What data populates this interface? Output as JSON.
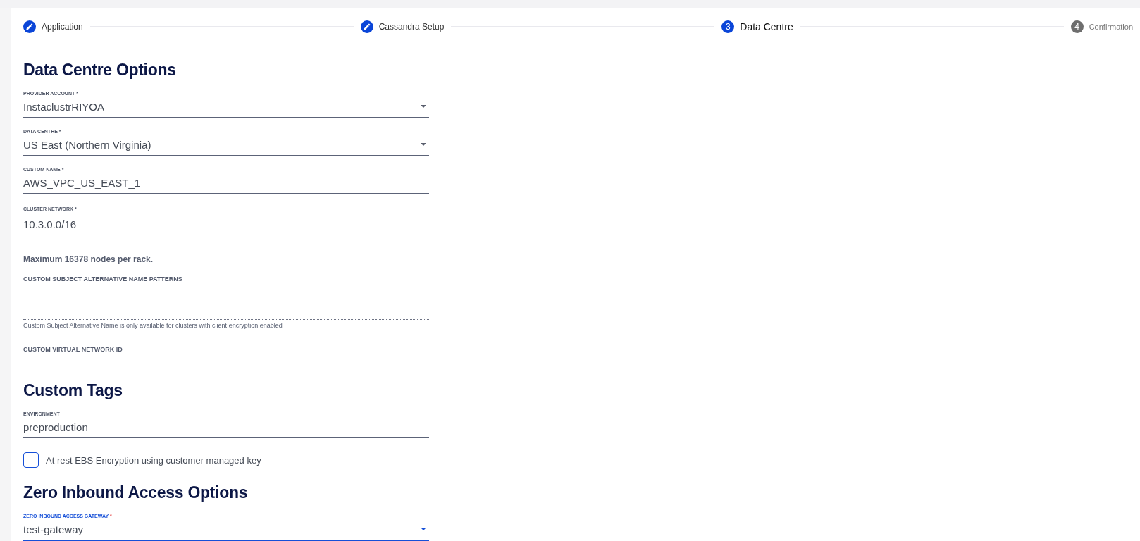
{
  "stepper": [
    {
      "label": "Application",
      "kind": "edited",
      "selected": false
    },
    {
      "label": "Cassandra Setup",
      "kind": "edited",
      "selected": false
    },
    {
      "label": "Data Centre",
      "kind": "numbered",
      "number": "3",
      "selected": true
    },
    {
      "label": "Confirmation",
      "kind": "numbered",
      "number": "4",
      "selected": false
    }
  ],
  "sections": [
    {
      "heading": "Data Centre Options",
      "items": [
        {
          "kind": "select",
          "label": "PROVIDER ACCOUNT",
          "required_mark": "*",
          "value": "InstaclustrRIYOA",
          "focused": false
        },
        {
          "kind": "select",
          "label": "DATA CENTRE",
          "required_mark": "*",
          "value": "US East (Northern Virginia)",
          "focused": false
        },
        {
          "kind": "text",
          "label": "CUSTOM NAME",
          "required_mark": "*",
          "value": "AWS_VPC_US_EAST_1",
          "focused": false
        },
        {
          "kind": "static",
          "label": "CLUSTER NETWORK",
          "required_mark": "*",
          "value": "10.3.0.0/16"
        },
        {
          "kind": "note",
          "text": "Maximum 16378 nodes per rack."
        },
        {
          "kind": "disabled-field",
          "label": "CUSTOM SUBJECT ALTERNATIVE NAME PATTERNS",
          "hint": "Custom Subject Alternative Name is only available for clusters with client encryption enabled"
        },
        {
          "kind": "bare-label",
          "label": "CUSTOM VIRTUAL NETWORK ID"
        }
      ]
    },
    {
      "heading": "Custom Tags",
      "items": [
        {
          "kind": "text",
          "label": "ENVIRONMENT",
          "value": "preproduction",
          "focused": false
        },
        {
          "kind": "checkbox",
          "label": "At rest EBS Encryption using customer managed key",
          "checked": false
        }
      ]
    },
    {
      "heading": "Zero Inbound Access Options",
      "items": [
        {
          "kind": "select",
          "label": "ZERO INBOUND ACCESS GATEWAY",
          "required_mark": "*",
          "value": "test-gateway",
          "focused": true
        }
      ]
    }
  ]
}
